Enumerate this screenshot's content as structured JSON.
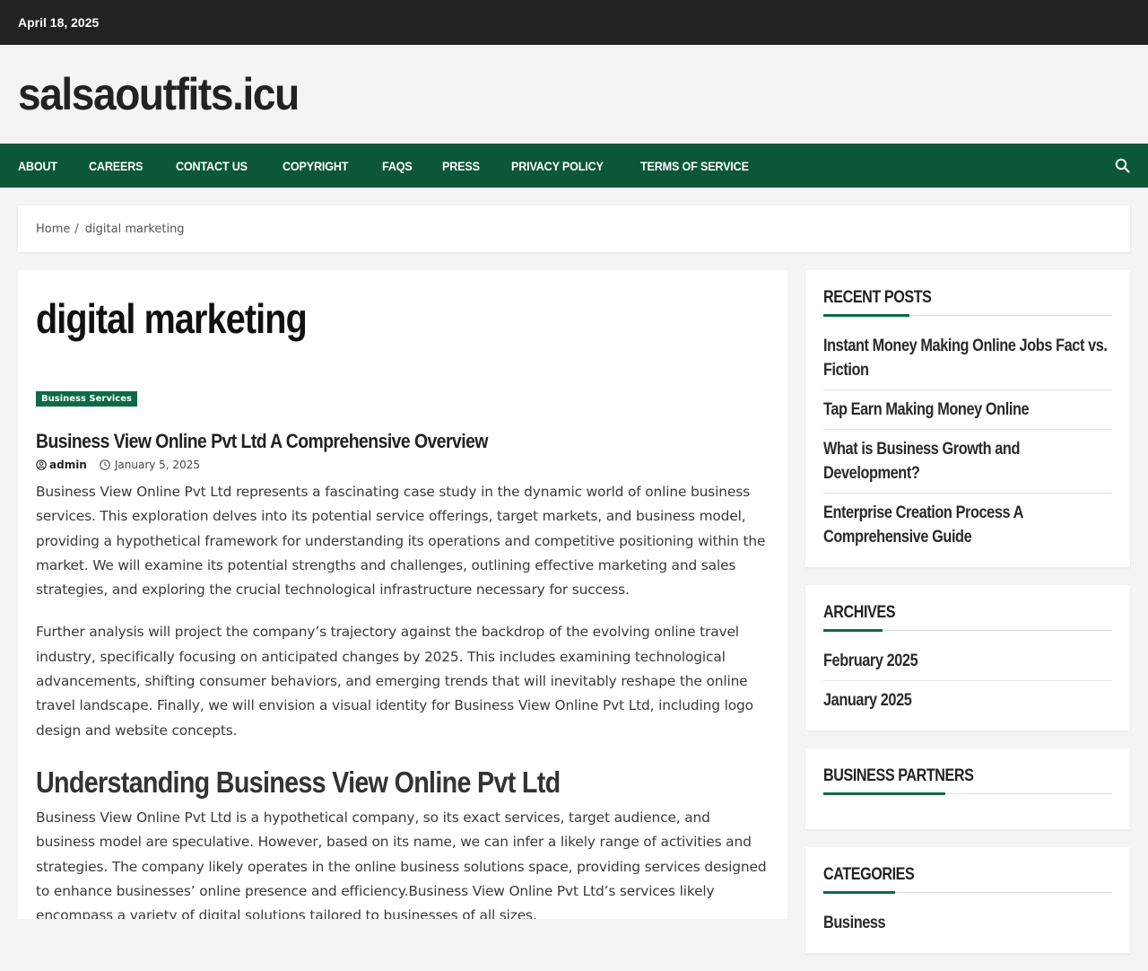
{
  "topbar": {
    "date": "April 18, 2025"
  },
  "site": {
    "title": "salsaoutfits.icu"
  },
  "nav": {
    "items": [
      "About",
      "Careers",
      "Contact Us",
      "Copyright",
      "FAQs",
      "Press",
      "Privacy Policy",
      "Terms of Service"
    ],
    "search_icon": "search-icon"
  },
  "breadcrumb": {
    "home": "Home",
    "separator": "/",
    "current": "digital marketing"
  },
  "main": {
    "page_title": "digital marketing",
    "category_badge": "Business Services",
    "post_title": "Business View Online Pvt Ltd A Comprehensive Overview",
    "author": "admin",
    "date": "January 5, 2025",
    "paragraphs": [
      "Business View Online Pvt Ltd represents a fascinating case study in the dynamic world of online business services. This exploration delves into its potential service offerings, target markets, and business model, providing a hypothetical framework for understanding its operations and competitive positioning within the market. We will examine its potential strengths and challenges, outlining effective marketing and sales strategies, and exploring the crucial technological infrastructure necessary for success.",
      "Further analysis will project the company’s trajectory against the backdrop of the evolving online travel industry, specifically focusing on anticipated changes by 2025. This includes examining technological advancements, shifting consumer behaviors, and emerging trends that will inevitably reshape the online travel landscape. Finally, we will envision a visual identity for Business View Online Pvt Ltd, including logo design and website concepts."
    ],
    "heading2": "Understanding Business View Online Pvt Ltd",
    "paragraph3": "Business View Online Pvt Ltd is a hypothetical company, so its exact services, target audience, and business model are speculative. However, based on its name, we can infer a likely range of activities and strategies. The company likely operates in the online business solutions space, providing services designed to enhance businesses’ online presence and efficiency.Business View Online Pvt Ltd’s services likely encompass a variety of digital solutions tailored to businesses of all sizes."
  },
  "sidebar": {
    "recent_posts": {
      "title": "Recent Posts",
      "items": [
        "Instant Money Making Online Jobs Fact vs. Fiction",
        "Tap Earn Making Money Online",
        "What is Business Growth and Development?",
        "Enterprise Creation Process A Comprehensive Guide"
      ]
    },
    "archives": {
      "title": "Archives",
      "items": [
        "February 2025",
        "January 2025"
      ]
    },
    "partners": {
      "title": "Business Partners"
    },
    "categories": {
      "title": "Categories",
      "items": [
        "Business"
      ]
    }
  },
  "colors": {
    "nav_bg": "#0b5737",
    "accent": "#0b6b45",
    "topbar_bg": "#222222"
  }
}
